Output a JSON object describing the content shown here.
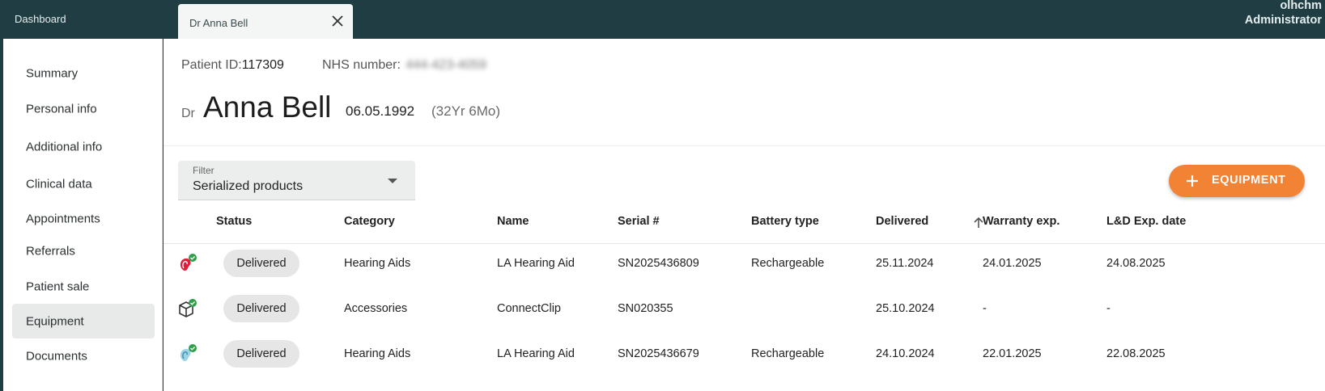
{
  "header": {
    "dashboard_tab": "Dashboard",
    "patient_tab": "Dr Anna Bell",
    "user_name": "olhchm",
    "user_role": "Administrator"
  },
  "sidebar": {
    "items": [
      {
        "label": "Summary"
      },
      {
        "label": "Personal info"
      },
      {
        "label": "Additional info"
      },
      {
        "label": "Clinical data"
      },
      {
        "label": "Appointments"
      },
      {
        "label": "Referrals"
      },
      {
        "label": "Patient sale"
      },
      {
        "label": "Equipment",
        "active": true
      },
      {
        "label": "Documents"
      }
    ]
  },
  "patient": {
    "id_label": "Patient ID:",
    "id": "117309",
    "nhs_label": "NHS number:",
    "nhs": "444-423-4059",
    "prefix": "Dr",
    "name": "Anna Bell",
    "dob": "06.05.1992",
    "age": "(32Yr 6Mo)"
  },
  "filter": {
    "label": "Filter",
    "value": "Serialized products"
  },
  "add_button": "EQUIPMENT",
  "table": {
    "columns": [
      "Status",
      "Category",
      "Name",
      "Serial #",
      "Battery type",
      "Delivered",
      "Warranty exp.",
      "L&D Exp. date"
    ],
    "rows": [
      {
        "icon": "red-hearing-aid-icon",
        "status": "Delivered",
        "category": "Hearing Aids",
        "name": "LA Hearing Aid",
        "serial": "SN2025436809",
        "battery": "Rechargeable",
        "delivered": "25.11.2024",
        "warranty": "24.01.2025",
        "ld": "24.08.2025"
      },
      {
        "icon": "box-icon",
        "status": "Delivered",
        "category": "Accessories",
        "name": "ConnectClip",
        "serial": "SN020355",
        "battery": "",
        "delivered": "25.10.2024",
        "warranty": "-",
        "ld": "-"
      },
      {
        "icon": "blue-hearing-aid-icon",
        "status": "Delivered",
        "category": "Hearing Aids",
        "name": "LA Hearing Aid",
        "serial": "SN2025436679",
        "battery": "Rechargeable",
        "delivered": "24.10.2024",
        "warranty": "22.01.2025",
        "ld": "22.08.2025"
      }
    ]
  },
  "colors": {
    "topbar": "#1f3d42",
    "accent": "#f28234",
    "check": "#2e9e4a"
  }
}
